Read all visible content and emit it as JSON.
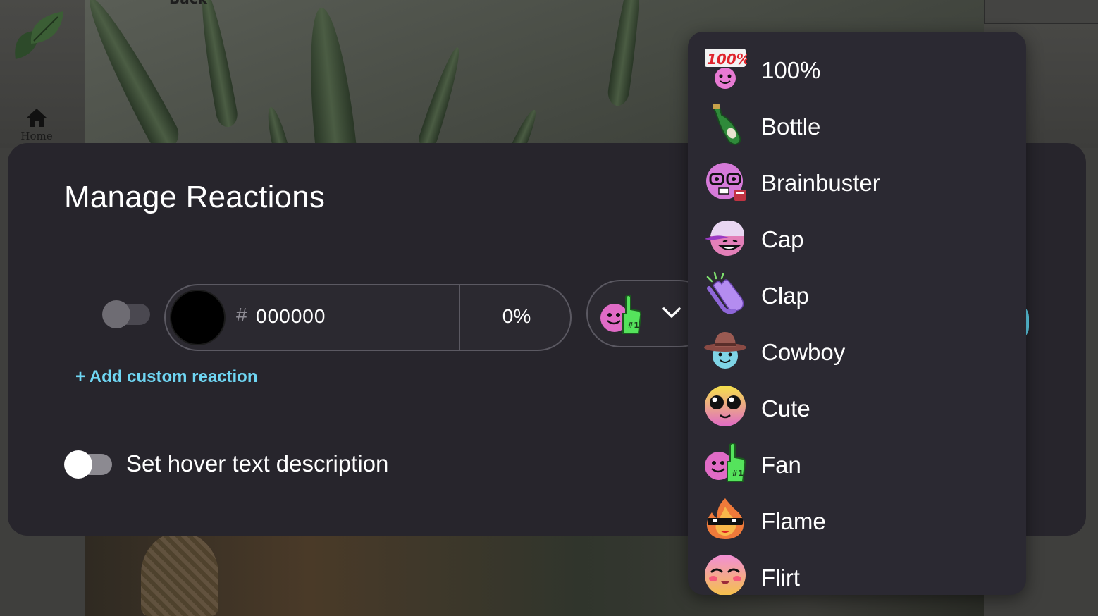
{
  "background": {
    "back_label": "Back",
    "home_label": "Home"
  },
  "modal": {
    "title": "Manage Reactions",
    "color_row": {
      "hash_symbol": "#",
      "hex_value": "000000",
      "opacity_value": "0%",
      "swatch_color": "#000000",
      "selected_reaction": "Fan"
    },
    "add_custom_label": "+ Add custom reaction",
    "hover_toggle_label": "Set hover text description"
  },
  "menu": {
    "items": [
      {
        "label": "100%",
        "icon": "hundred-percent-icon"
      },
      {
        "label": "Bottle",
        "icon": "bottle-icon"
      },
      {
        "label": "Brainbuster",
        "icon": "brainbuster-icon"
      },
      {
        "label": "Cap",
        "icon": "cap-icon"
      },
      {
        "label": "Clap",
        "icon": "clap-icon"
      },
      {
        "label": "Cowboy",
        "icon": "cowboy-icon"
      },
      {
        "label": "Cute",
        "icon": "cute-icon"
      },
      {
        "label": "Fan",
        "icon": "fan-icon"
      },
      {
        "label": "Flame",
        "icon": "flame-icon"
      },
      {
        "label": "Flirt",
        "icon": "flirt-icon"
      }
    ]
  },
  "colors": {
    "accent_cyan": "#6fd6f3",
    "modal_bg": "#27252c",
    "menu_bg": "#2b2932"
  }
}
